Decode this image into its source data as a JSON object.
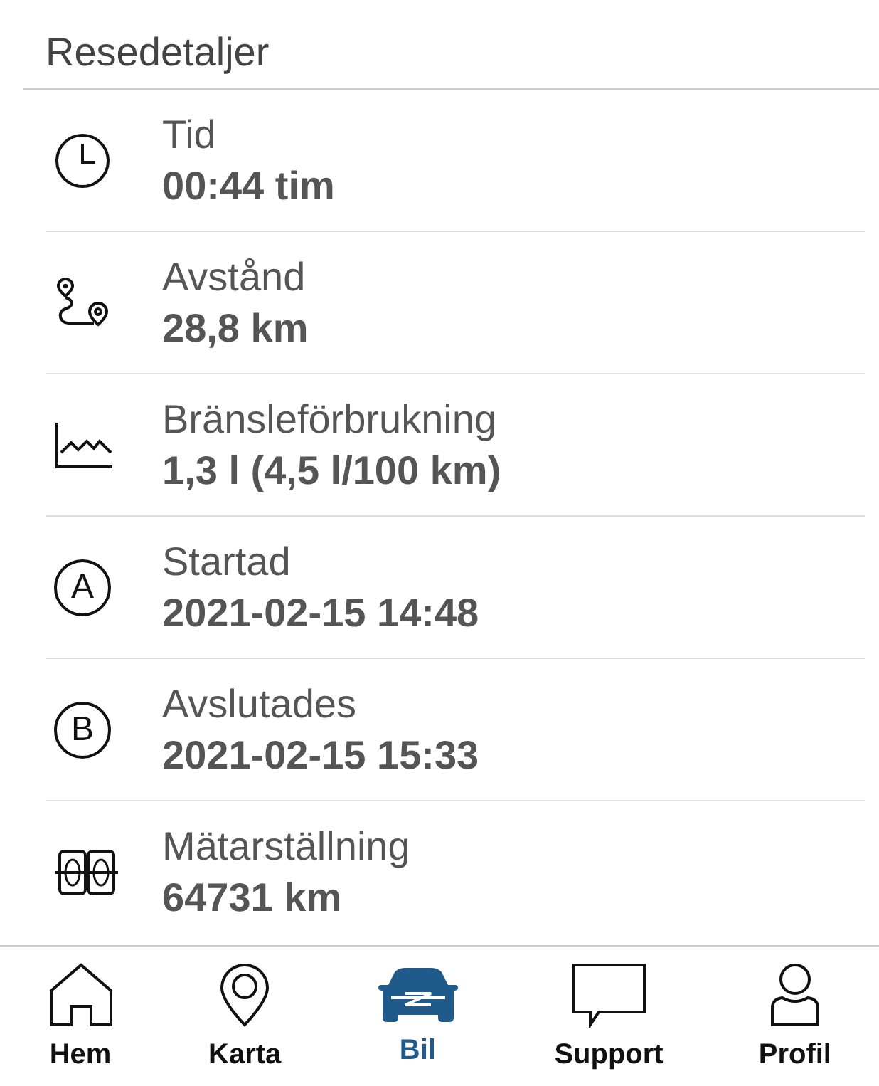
{
  "header": {
    "title": "Resedetaljer"
  },
  "details": [
    {
      "kind": "clock",
      "label": "Tid",
      "value": "00:44 tim"
    },
    {
      "kind": "route",
      "label": "Avstånd",
      "value": "28,8 km"
    },
    {
      "kind": "chart",
      "label": "Bränsleförbrukning",
      "value": "1,3 l (4,5 l/100 km)"
    },
    {
      "kind": "letter",
      "letter": "A",
      "label": "Startad",
      "value": "2021-02-15 14:48"
    },
    {
      "kind": "letter",
      "letter": "B",
      "label": "Avslutades",
      "value": "2021-02-15 15:33"
    },
    {
      "kind": "odometer",
      "label": "Mätarställning",
      "value": "64731 km"
    }
  ],
  "tab_bar": [
    {
      "kind": "home",
      "label": "Hem",
      "selected": false
    },
    {
      "kind": "map",
      "label": "Karta",
      "selected": false
    },
    {
      "kind": "car",
      "label": "Bil",
      "selected": true
    },
    {
      "kind": "chat",
      "label": "Support",
      "selected": false
    },
    {
      "kind": "profile",
      "label": "Profil",
      "selected": false
    }
  ]
}
